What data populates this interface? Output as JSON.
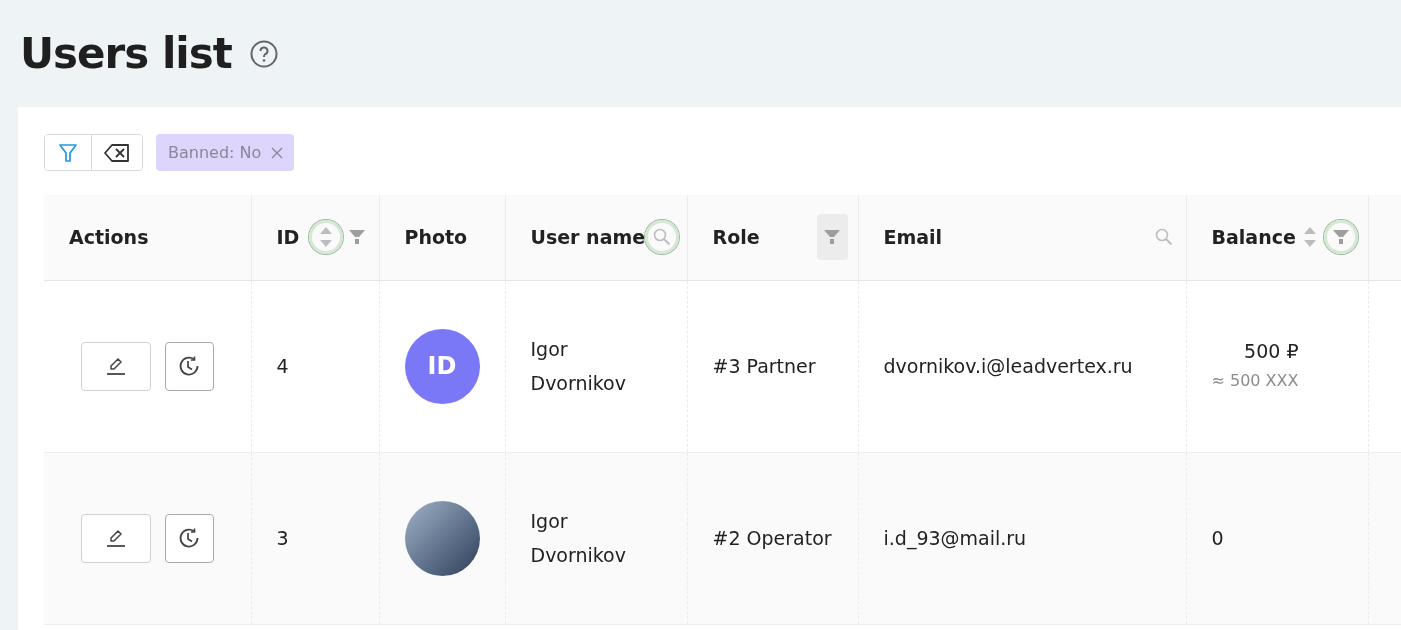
{
  "page": {
    "title": "Users list"
  },
  "filter_bar": {
    "tags": [
      {
        "label": "Banned: No"
      }
    ]
  },
  "table": {
    "columns": [
      {
        "label": "Actions"
      },
      {
        "label": "ID",
        "tools": [
          {
            "kind": "sort",
            "highlighted": true,
            "active": false
          },
          {
            "kind": "filter",
            "highlighted": false,
            "active": false
          }
        ]
      },
      {
        "label": "Photo"
      },
      {
        "label": "User name",
        "tools": [
          {
            "kind": "search",
            "highlighted": true,
            "active": false
          }
        ]
      },
      {
        "label": "Role",
        "tools": [
          {
            "kind": "filter",
            "highlighted": false,
            "active": true
          }
        ]
      },
      {
        "label": "Email",
        "tools": [
          {
            "kind": "search",
            "highlighted": false,
            "active": false
          }
        ]
      },
      {
        "label": "Balance",
        "tools": [
          {
            "kind": "sort",
            "highlighted": false,
            "active": false
          },
          {
            "kind": "filter",
            "highlighted": true,
            "active": false
          }
        ]
      }
    ],
    "rows": [
      {
        "id": "4",
        "avatar": {
          "kind": "initials",
          "text": "ID",
          "color": "#7a78f7"
        },
        "name": "Igor Dvornikov",
        "role": "#3 Partner",
        "email": "dvornikov.i@leadvertex.ru",
        "balance": "500 ₽",
        "balance_approx": "≈ 500 XXX"
      },
      {
        "id": "3",
        "avatar": {
          "kind": "photo"
        },
        "name": "Igor Dvornikov",
        "role": "#2 Operator",
        "email": "i.d_93@mail.ru",
        "balance": "0"
      }
    ]
  }
}
